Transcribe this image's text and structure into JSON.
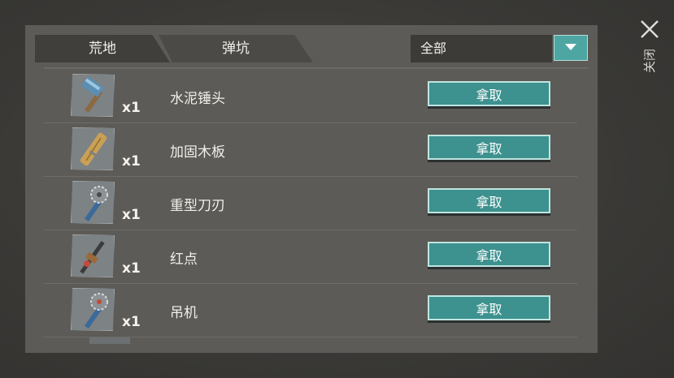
{
  "tabs": [
    {
      "label": "荒地"
    },
    {
      "label": "弹坑"
    }
  ],
  "filter": {
    "value": "全部"
  },
  "items": [
    {
      "name": "水泥锤头",
      "qty": "x1",
      "icon": "hammer-head-icon",
      "action": "拿取"
    },
    {
      "name": "加固木板",
      "qty": "x1",
      "icon": "wooden-plank-icon",
      "action": "拿取"
    },
    {
      "name": "重型刀刃",
      "qty": "x1",
      "icon": "heavy-blade-icon",
      "action": "拿取"
    },
    {
      "name": "红点",
      "qty": "x1",
      "icon": "red-dot-sight-icon",
      "action": "拿取"
    },
    {
      "name": "吊机",
      "qty": "x1",
      "icon": "crane-icon",
      "action": "拿取"
    }
  ],
  "close": {
    "label": "关闭"
  },
  "colors": {
    "accent": "#3d918e",
    "panel": "#5c5b57",
    "tab_active": "#403f3c"
  }
}
